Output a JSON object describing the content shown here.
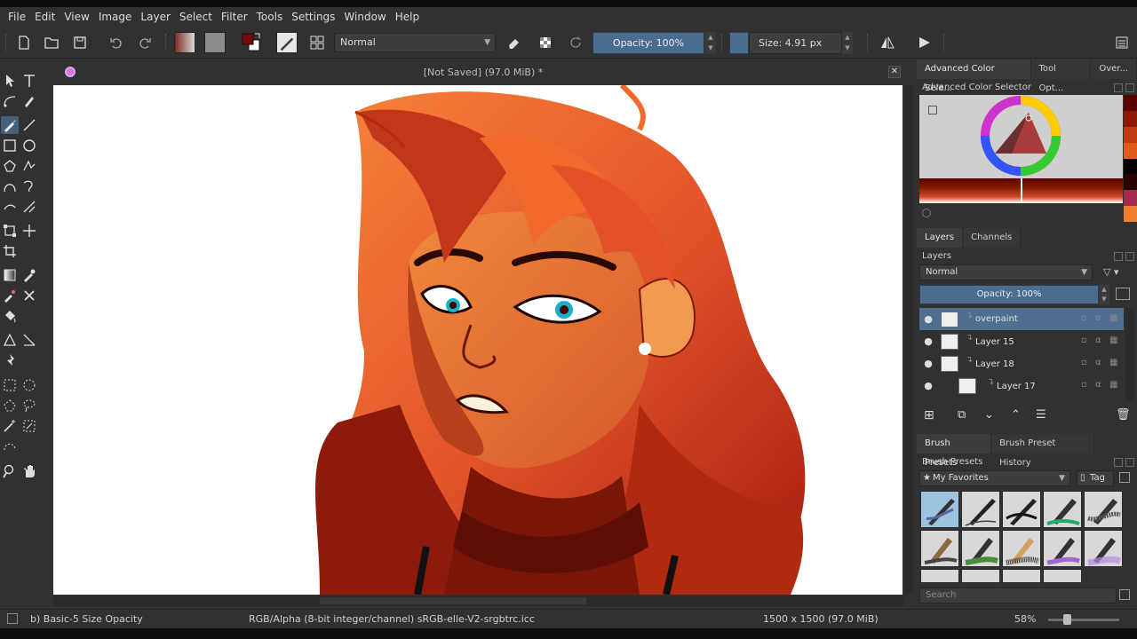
{
  "menu": [
    "File",
    "Edit",
    "View",
    "Image",
    "Layer",
    "Select",
    "Filter",
    "Tools",
    "Settings",
    "Window",
    "Help"
  ],
  "toolbar": {
    "blend_mode": "Normal",
    "opacity_label": "Opacity: 100%",
    "size_label": "Size: 4.91 px"
  },
  "document": {
    "title": "[Not Saved]  (97.0 MiB) *",
    "close_glyph": "✕"
  },
  "dock": {
    "tabs": [
      "Advanced Color Sele...",
      "Tool Opt...",
      "Over..."
    ],
    "color_selector_title": "Advanced Color Selector",
    "layers_tabs": [
      "Layers",
      "Channels"
    ],
    "layers_title": "Layers",
    "layers_blend": "Normal",
    "layers_opacity": "Opacity:  100%",
    "layers": [
      {
        "name": "overpaint",
        "selected": true
      },
      {
        "name": "Layer 15",
        "selected": false
      },
      {
        "name": "Layer 18",
        "selected": false
      },
      {
        "name": "Layer 17",
        "selected": false
      }
    ],
    "brush_tabs": [
      "Brush Presets",
      "Brush Preset History"
    ],
    "brush_title": "Brush Presets",
    "brush_tag_combo": "My Favorites",
    "brush_tag_button": "Tag",
    "search_placeholder": "Search"
  },
  "status": {
    "brush": "b) Basic-5 Size Opacity",
    "colorspace": "RGB/Alpha (8-bit integer/channel)  sRGB-elle-V2-srgbtrc.icc",
    "dimensions": "1500 x 1500 (97.0 MiB)",
    "zoom": "58%"
  },
  "colors": {
    "accent": "#4f6f92",
    "hair": "#f26a2a",
    "swatches": [
      "#5a0000",
      "#8a1a00",
      "#c23a10",
      "#e55a1a",
      "#000000",
      "#2a0000",
      "#a52a50",
      "#f08030"
    ]
  }
}
